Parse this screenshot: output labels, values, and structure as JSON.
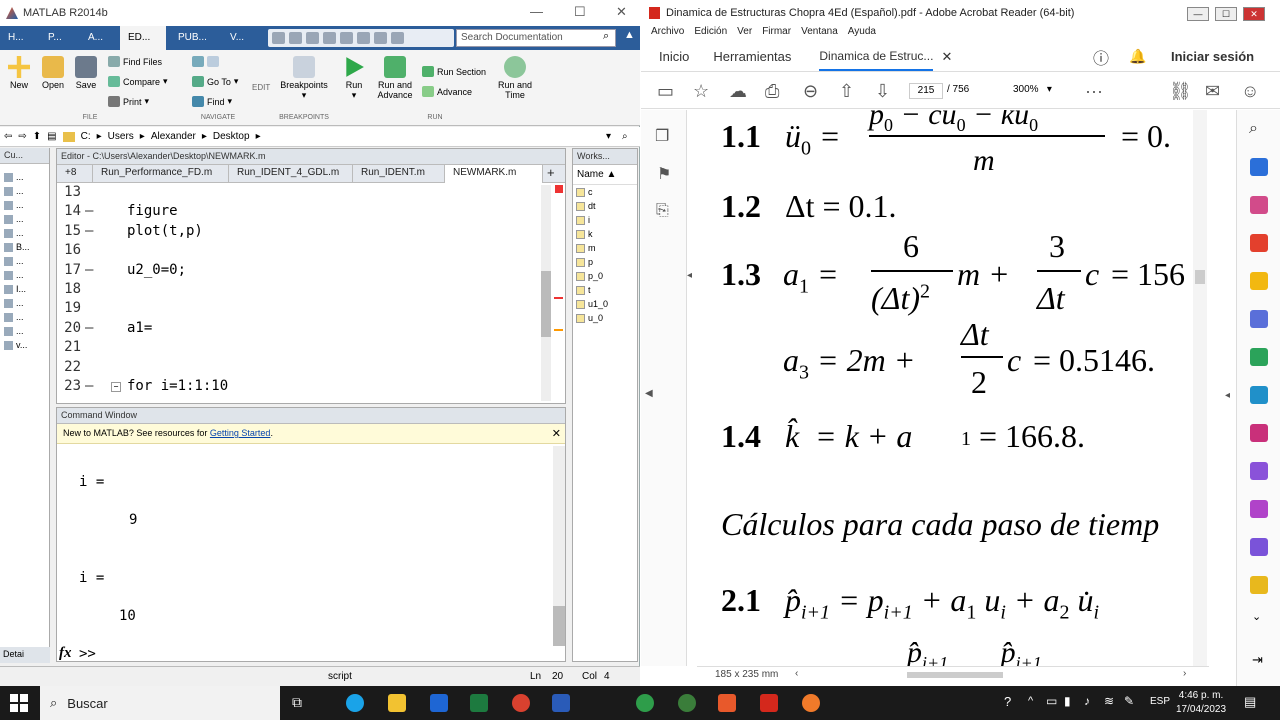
{
  "matlab": {
    "title": "MATLAB R2014b",
    "tabs": [
      "H...",
      "P...",
      "A...",
      "ED...",
      "PUB...",
      "V..."
    ],
    "search_placeholder": "Search Documentation",
    "ribbon": {
      "new": "New",
      "open": "Open",
      "save": "Save",
      "find_files": "Find Files",
      "compare": "Compare",
      "print": "Print",
      "go_to": "Go To",
      "find": "Find",
      "edit": "EDIT",
      "breakpoints": "Breakpoints",
      "run": "Run",
      "run_and_advance": "Run and Advance",
      "run_section": "Run Section",
      "advance": "Advance",
      "run_and_time": "Run and Time",
      "groups": [
        "FILE",
        "NAVIGATE",
        "BREAKPOINTS",
        "RUN"
      ]
    },
    "address": [
      "C:",
      "Users",
      "Alexander",
      "Desktop"
    ],
    "current_folder_label": "Cu...",
    "current_folder_items": [
      "...",
      "...",
      "...",
      "...",
      "...",
      "B...",
      "...",
      "...",
      "I...",
      "...",
      "...",
      "...",
      "v..."
    ],
    "editor": {
      "header": "Editor - C:\\Users\\Alexander\\Desktop\\NEWMARK.m",
      "tab_count": "+8",
      "tabs": [
        "Run_Performance_FD.m",
        "Run_IDENT_4_GDL.m",
        "Run_IDENT.m",
        "NEWMARK.m"
      ],
      "lines": [
        {
          "n": "13",
          "dash": "",
          "code": ""
        },
        {
          "n": "14",
          "dash": "–",
          "code": "figure"
        },
        {
          "n": "15",
          "dash": "–",
          "code": "plot(t,p)"
        },
        {
          "n": "16",
          "dash": "",
          "code": ""
        },
        {
          "n": "17",
          "dash": "–",
          "code": "u2_0=0;"
        },
        {
          "n": "18",
          "dash": "",
          "code": ""
        },
        {
          "n": "19",
          "dash": "",
          "code": ""
        },
        {
          "n": "20",
          "dash": "–",
          "code": "a1="
        },
        {
          "n": "21",
          "dash": "",
          "code": ""
        },
        {
          "n": "22",
          "dash": "",
          "code": ""
        },
        {
          "n": "23",
          "dash": "–",
          "code": "for i=1:1:10"
        }
      ]
    },
    "command_window": {
      "header": "Command Window",
      "banner_text": "New to MATLAB? See resources for ",
      "banner_link": "Getting Started",
      "banner_end": ".",
      "out1_label": "i =",
      "out1_value": "9",
      "out2_label": "i =",
      "out2_value": "10",
      "prompt": ">>",
      "fx": "fx"
    },
    "workspace": {
      "header": "Works...",
      "col_name": "Name",
      "vars": [
        "c",
        "dt",
        "i",
        "k",
        "m",
        "p",
        "p_0",
        "t",
        "u1_0",
        "u_0"
      ]
    },
    "details_label": "Detai",
    "status": {
      "mode": "script",
      "ln_label": "Ln",
      "ln": "20",
      "col_label": "Col",
      "col": "4"
    }
  },
  "acrobat": {
    "title": "Dinamica de Estructuras Chopra 4Ed (Español).pdf - Adobe Acrobat Reader (64-bit)",
    "menu": [
      "Archivo",
      "Edición",
      "Ver",
      "Firmar",
      "Ventana",
      "Ayuda"
    ],
    "tabs": {
      "home": "Inicio",
      "tools": "Herramientas",
      "doc": "Dinamica de Estruc...",
      "sign_in": "Iniciar sesión"
    },
    "page_current": "215",
    "page_total": "/ 756",
    "zoom": "300%",
    "page_size": "185 x 235 mm",
    "content": {
      "s11": "1.1",
      "s12": "1.2",
      "s13": "1.3",
      "s14": "1.4",
      "s21": "2.1",
      "eq12": "Δt = 0.1.",
      "eq14": "= k + a",
      "eq14_end": "= 166.8.",
      "heading": "Cálculos para cada paso de tiemp",
      "eq13_result": "= 156",
      "eq13b_result": "= 0.5146.",
      "eq11_result": "= 0."
    }
  },
  "taskbar": {
    "search": "Buscar",
    "lang": "ESP",
    "time": "4:46 p. m.",
    "date": "17/04/2023"
  },
  "colors": {
    "matlab_blue": "#2c5d9a",
    "taskbar": "#1a1a1a",
    "acrobat_red": "#d4281c"
  }
}
